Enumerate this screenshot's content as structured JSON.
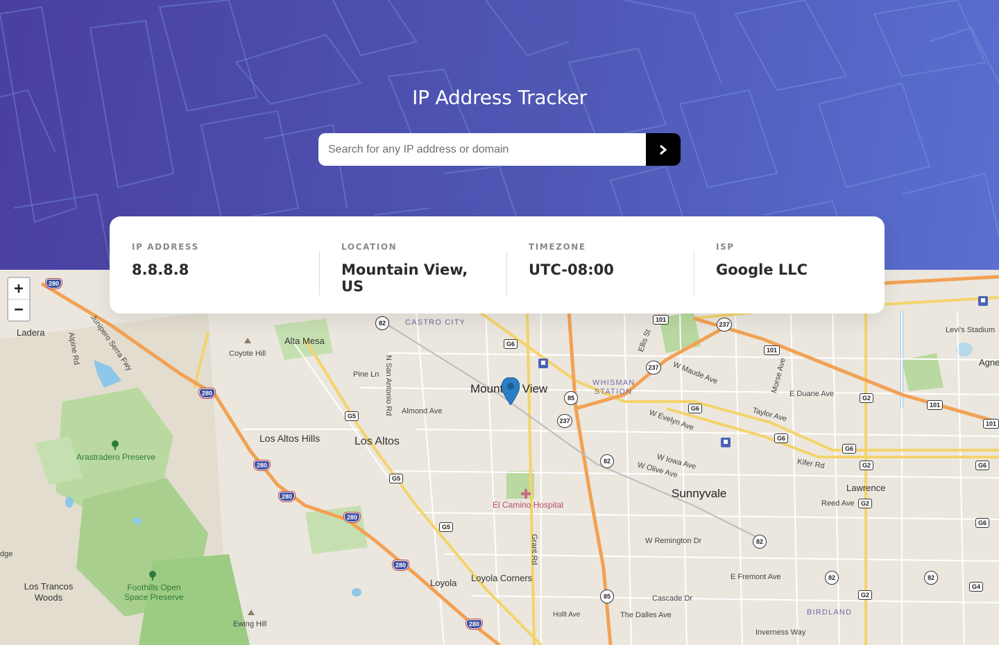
{
  "header": {
    "title": "IP Address Tracker",
    "search_placeholder": "Search for any IP address or domain",
    "search_value": ""
  },
  "info": {
    "ip": {
      "label": "IP ADDRESS",
      "value": "8.8.8.8"
    },
    "location": {
      "label": "LOCATION",
      "value": "Mountain View, US"
    },
    "timezone": {
      "label": "TIMEZONE",
      "value": "UTC-08:00"
    },
    "isp": {
      "label": "ISP",
      "value": "Google LLC"
    }
  },
  "map": {
    "zoom_in": "+",
    "zoom_out": "−",
    "labels": {
      "mountain_view": "Mountain View",
      "sunnyvale": "Sunnyvale",
      "los_altos": "Los Altos",
      "los_altos_hills": "Los Altos Hills",
      "alta_mesa": "Alta Mesa",
      "ladera": "Ladera",
      "coyote_hill": "Coyote Hill",
      "castro_city": "CASTRO CITY",
      "whisman_station": "WHISMAN STATION",
      "birdland": "BIRDLAND",
      "lawrence": "Lawrence",
      "loyola": "Loyola",
      "loyola_corners": "Loyola Corners",
      "los_trancos": "Los Trancos Woods",
      "arastradero": "Arastradero Preserve",
      "foothills": "Foothills Open Space Preserve",
      "ewing_hill": "Ewing Hill",
      "el_camino": "El Camino Hospital",
      "levis": "Levi's Stadium",
      "pine_ln": "Pine Ln",
      "almond_ave": "Almond Ave",
      "n_san_antonio": "N San Antonio Rd",
      "w_evelyn": "W Evelyn Ave",
      "w_iowa": "W Iowa Ave",
      "w_olive": "W Olive Ave",
      "w_maude": "W Maude Ave",
      "e_duane": "E Duane Ave",
      "taylor": "Taylor Ave",
      "kifer": "Kifer Rd",
      "reed": "Reed Ave",
      "w_remington": "W Remington Dr",
      "e_fremont": "E Fremont Ave",
      "cascade": "Cascade Dr",
      "dalles": "The Dalles Ave",
      "inverness": "Inverness Way",
      "hollt": "Hollt Ave",
      "grant": "Grant Rd",
      "junipero": "Junipero Serra Fwy",
      "alpine": "Alpine Rd",
      "agnew": "Agne",
      "edge": "dge",
      "ellis": "Ellis St",
      "morse": "Morse Ave"
    },
    "shields": {
      "i280": "280",
      "r82": "82",
      "r85": "85",
      "r237": "237",
      "r101": "101",
      "g5": "G5",
      "g6": "G6",
      "g2": "G2",
      "g4": "G4"
    },
    "colors": {
      "highway": "#f2a154",
      "major": "#f4d36b",
      "park": "#b9d9a0",
      "water": "#8fc7e8"
    }
  }
}
